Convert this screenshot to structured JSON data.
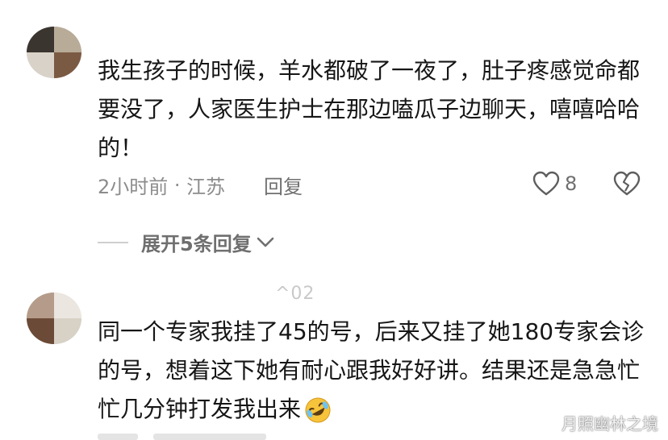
{
  "comments": [
    {
      "username": "",
      "text": "我生孩子的时候，羊水都破了一夜了，肚子疼感觉命都要没了，人家医生护士在那边嗑瓜子边聊天，嘻嘻哈哈的！",
      "time": "2小时前",
      "location": "江苏",
      "reply_label": "回复",
      "likes": "8",
      "expand_label": "展开5条回复"
    },
    {
      "username": "^02",
      "text": "同一个专家我挂了45的号，后来又挂了她180专家会诊的号，想着这下她有耐心跟我好好讲。结果还是急急忙忙几分钟打发我出来"
    }
  ],
  "watermark": "月照幽林之境",
  "icons": {
    "like": "heart-outline-icon",
    "dislike": "broken-heart-icon",
    "expand": "chevron-down-icon",
    "emoji": "rolling-on-floor-laughing-emoji"
  }
}
